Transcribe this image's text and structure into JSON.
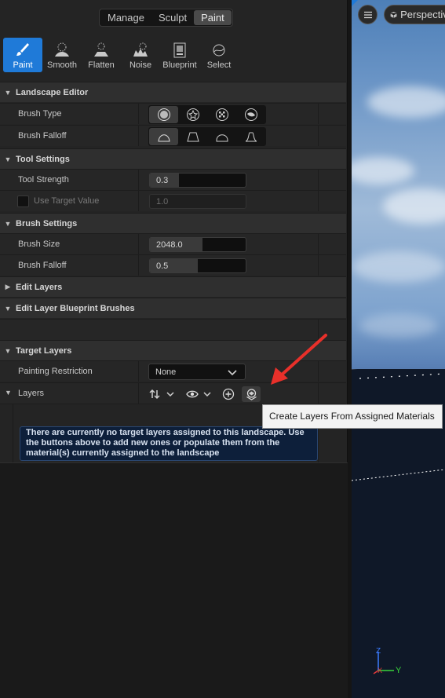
{
  "modes": [
    {
      "label": "Manage",
      "active": false
    },
    {
      "label": "Sculpt",
      "active": false
    },
    {
      "label": "Paint",
      "active": true
    }
  ],
  "tools": [
    {
      "label": "Paint",
      "icon": "brush-icon",
      "active": true
    },
    {
      "label": "Smooth",
      "icon": "smooth-icon",
      "active": false
    },
    {
      "label": "Flatten",
      "icon": "flatten-icon",
      "active": false
    },
    {
      "label": "Noise",
      "icon": "noise-icon",
      "active": false
    },
    {
      "label": "Blueprint",
      "icon": "blueprint-icon",
      "active": false
    },
    {
      "label": "Select",
      "icon": "select-icon",
      "active": false
    }
  ],
  "landscape_editor": {
    "title": "Landscape Editor",
    "brush_type_label": "Brush Type",
    "brush_falloff_label": "Brush Falloff",
    "brush_types": [
      "circle-brush-icon",
      "alpha-brush-icon",
      "pattern-brush-icon",
      "component-brush-icon"
    ],
    "brush_falloffs": [
      "smooth-falloff-icon",
      "linear-falloff-icon",
      "spherical-falloff-icon",
      "tip-falloff-icon"
    ]
  },
  "tool_settings": {
    "title": "Tool Settings",
    "tool_strength_label": "Tool Strength",
    "tool_strength_value": "0.3",
    "tool_strength_fraction": 0.3,
    "use_target_label": "Use Target Value",
    "use_target_value": "1.0"
  },
  "brush_settings": {
    "title": "Brush Settings",
    "size_label": "Brush Size",
    "size_value": "2048.0",
    "size_fraction": 0.55,
    "falloff_label": "Brush Falloff",
    "falloff_value": "0.5",
    "falloff_fraction": 0.5
  },
  "edit_layers": {
    "title": "Edit Layers"
  },
  "edit_layer_bp": {
    "title": "Edit Layer Blueprint Brushes"
  },
  "target_layers": {
    "title": "Target Layers",
    "restriction_label": "Painting Restriction",
    "restriction_value": "None",
    "layers_label": "Layers",
    "info_text": "There are currently no target layers assigned to this landscape. Use the buttons above to add new ones or populate them from the material(s) currently assigned to the landscape"
  },
  "tooltip": "Create Layers From Assigned Materials",
  "viewport": {
    "perspective_label": "Perspective"
  },
  "colors": {
    "accent": "#1f7ad8",
    "annotation_arrow": "#e8302a"
  }
}
